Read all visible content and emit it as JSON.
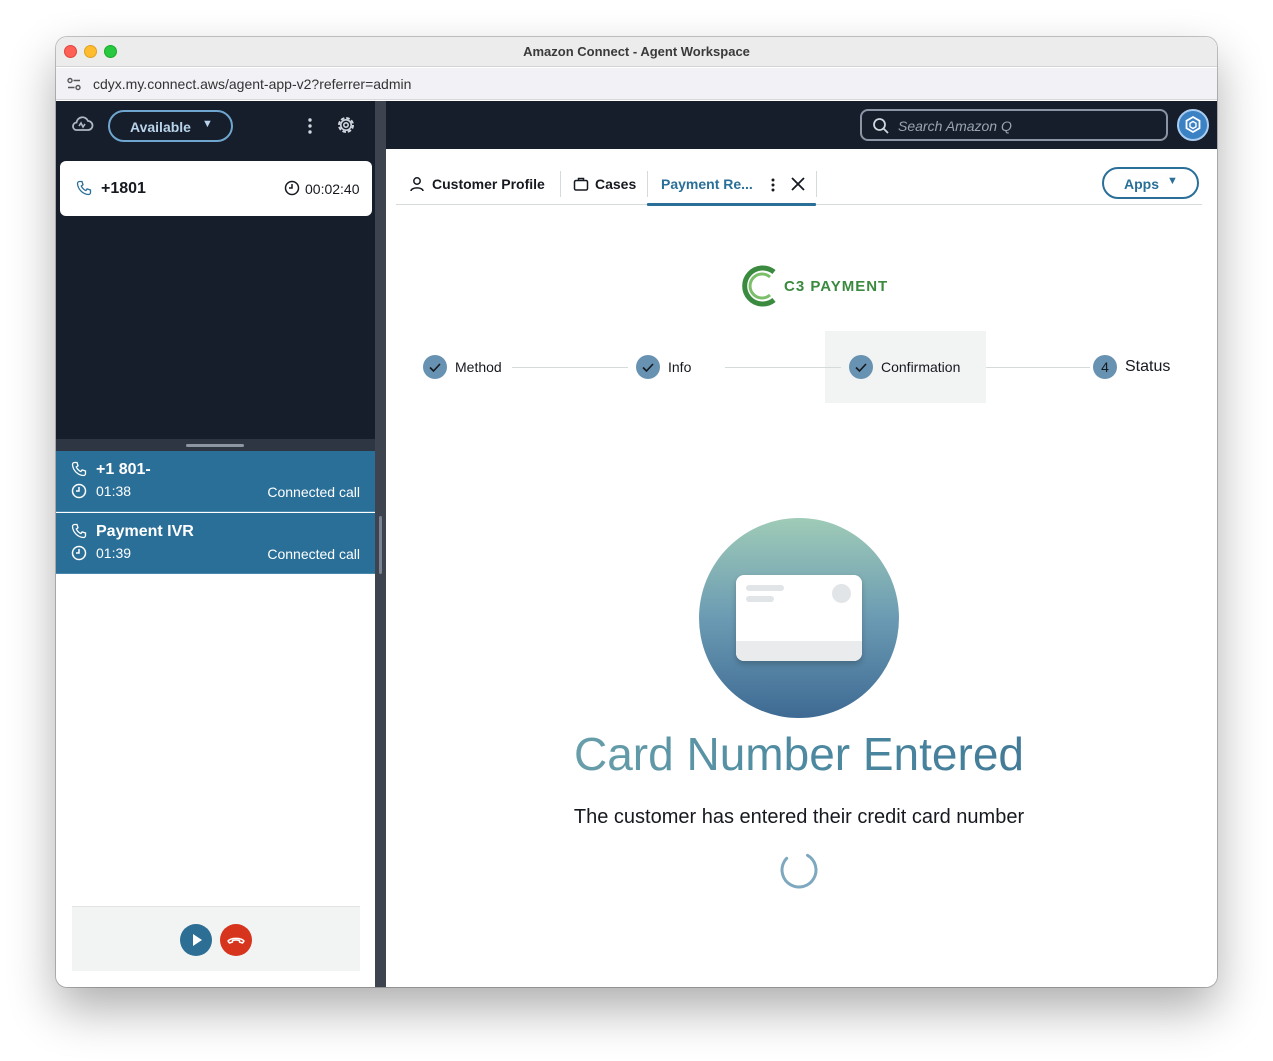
{
  "window": {
    "title": "Amazon Connect - Agent Workspace"
  },
  "browser": {
    "url": "cdyx.my.connect.aws/agent-app-v2?referrer=admin"
  },
  "agent": {
    "status": "Available"
  },
  "active_contact": {
    "number": "+1801",
    "timer": "00:02:40"
  },
  "calls": [
    {
      "name": "+1 801-",
      "time": "01:38",
      "status": "Connected call"
    },
    {
      "name": "Payment IVR",
      "time": "01:39",
      "status": "Connected call"
    }
  ],
  "search": {
    "placeholder": "Search Amazon Q"
  },
  "tabs": [
    {
      "label": "Customer Profile"
    },
    {
      "label": "Cases"
    },
    {
      "label": "Payment Re..."
    }
  ],
  "apps": {
    "label": "Apps"
  },
  "logo": {
    "text": "C3 PAYMENT"
  },
  "steps": [
    {
      "label": "Method",
      "state": "complete"
    },
    {
      "label": "Info",
      "state": "complete"
    },
    {
      "label": "Confirmation",
      "state": "complete"
    },
    {
      "label": "Status",
      "number": "4",
      "state": "current"
    }
  ],
  "main": {
    "headline": "Card Number Entered",
    "message": "The customer has entered their credit card number"
  },
  "colors": {
    "nav_dark": "#161d2b",
    "accent_blue": "#2a6f98",
    "hangup_red": "#d6341d",
    "brand_green": "#3a8a3f"
  }
}
